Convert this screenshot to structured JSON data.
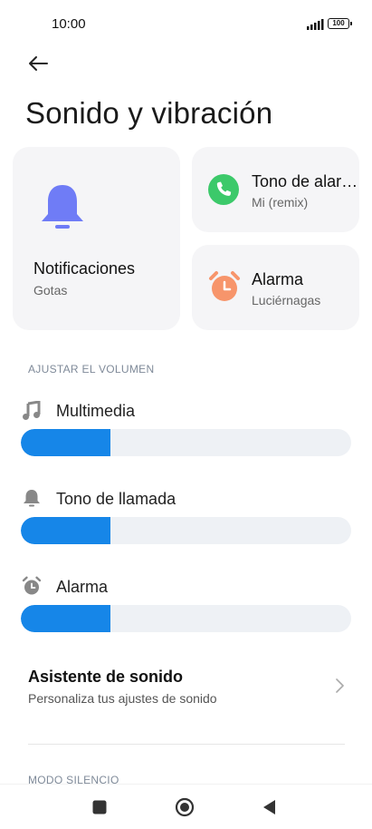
{
  "status": {
    "time": "10:00",
    "battery": "100"
  },
  "page": {
    "title": "Sonido y vibración"
  },
  "cards": {
    "notifications": {
      "title": "Notificaciones",
      "subtitle": "Gotas",
      "icon": "bell-icon",
      "color": "#6f7cf6"
    },
    "ringtone": {
      "title": "Tono de alar…",
      "subtitle": "Mi (remix)",
      "icon": "phone-icon",
      "color": "#3cc96a"
    },
    "alarm": {
      "title": "Alarma",
      "subtitle": "Luciérnagas",
      "icon": "alarm-clock-icon",
      "color": "#f7956b"
    }
  },
  "volume": {
    "section_label": "AJUSTAR EL VOLUMEN",
    "sliders": [
      {
        "label": "Multimedia",
        "icon": "music-note-icon",
        "level": 0.27
      },
      {
        "label": "Tono de llamada",
        "icon": "bell-icon",
        "level": 0.27
      },
      {
        "label": "Alarma",
        "icon": "alarm-clock-icon",
        "level": 0.27
      }
    ],
    "accent": "#1686e8"
  },
  "assistant": {
    "title": "Asistente de sonido",
    "subtitle": "Personaliza tus ajustes de sonido"
  },
  "silent_section": {
    "label": "MODO SILENCIO"
  },
  "nav": {
    "buttons": [
      "recents-icon",
      "home-icon",
      "back-icon"
    ]
  }
}
